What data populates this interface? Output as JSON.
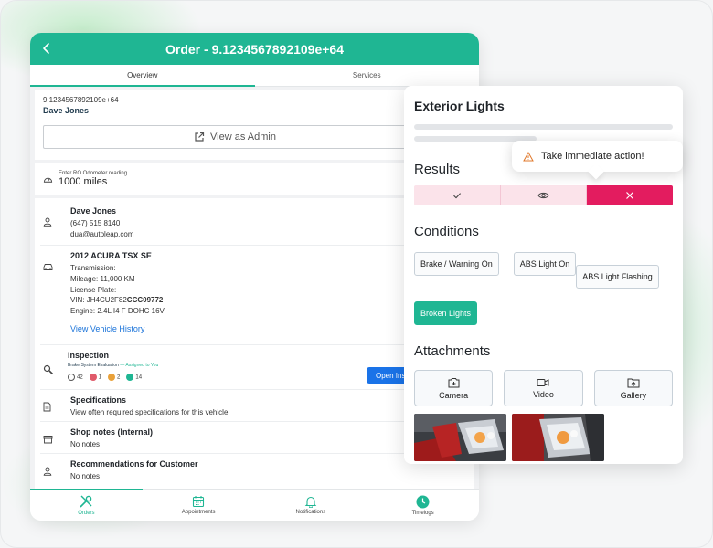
{
  "app": {
    "title": "Order - 9.1234567892109e+64",
    "tabs": [
      "Overview",
      "Services"
    ]
  },
  "ro": {
    "id": "9.1234567892109e+64",
    "customer_name": "Dave Jones",
    "view_admin_label": "View as Admin"
  },
  "odometer": {
    "label": "Enter RO Odometer reading",
    "value": "1000 miles"
  },
  "customer": {
    "name": "Dave Jones",
    "phone": "(647) 515 8140",
    "email": "dua@autoleap.com"
  },
  "vehicle": {
    "title": "2012 ACURA TSX SE",
    "transmission": "Transmission:",
    "mileage": "Mileage: 11,000 KM",
    "plate": "License Plate:",
    "vin_prefix": "VIN: JH4CU2F82",
    "vin_bold": "CCC09772",
    "engine": "Engine: 2.4L I4 F DOHC 16V",
    "history_link": "View Vehicle History"
  },
  "inspection": {
    "title": "Inspection",
    "name": "Brake System Evaluation",
    "assigned": "— Assigned to You",
    "counts": [
      "42",
      "1",
      "2",
      "14"
    ],
    "count_colors": [
      "#ffffff",
      "#e05a6a",
      "#e9a13a",
      "#1fb693"
    ],
    "open_label": "Open Inspe"
  },
  "specs": {
    "title": "Specifications",
    "desc": "View often required specifications for this vehicle"
  },
  "shop_notes": {
    "title": "Shop notes (Internal)",
    "value": "No notes"
  },
  "recommendations": {
    "title": "Recommendations for Customer",
    "value": "No notes"
  },
  "nav": [
    "Orders",
    "Appointments",
    "Notifications",
    "Timelogs"
  ],
  "panel": {
    "title": "Exterior Lights",
    "results_label": "Results",
    "tooltip": "Take immediate action!",
    "conditions_label": "Conditions",
    "conditions": [
      "Brake / Warning On",
      "ABS Light On",
      "ABS Light Flashing",
      "Broken Lights"
    ],
    "selected_condition": "Broken Lights",
    "attachments_label": "Attachments",
    "attachments": [
      "Camera",
      "Video",
      "Gallery"
    ]
  },
  "colors": {
    "brand": "#1fb693",
    "fail": "#e31c5f",
    "link": "#1a73d9"
  }
}
